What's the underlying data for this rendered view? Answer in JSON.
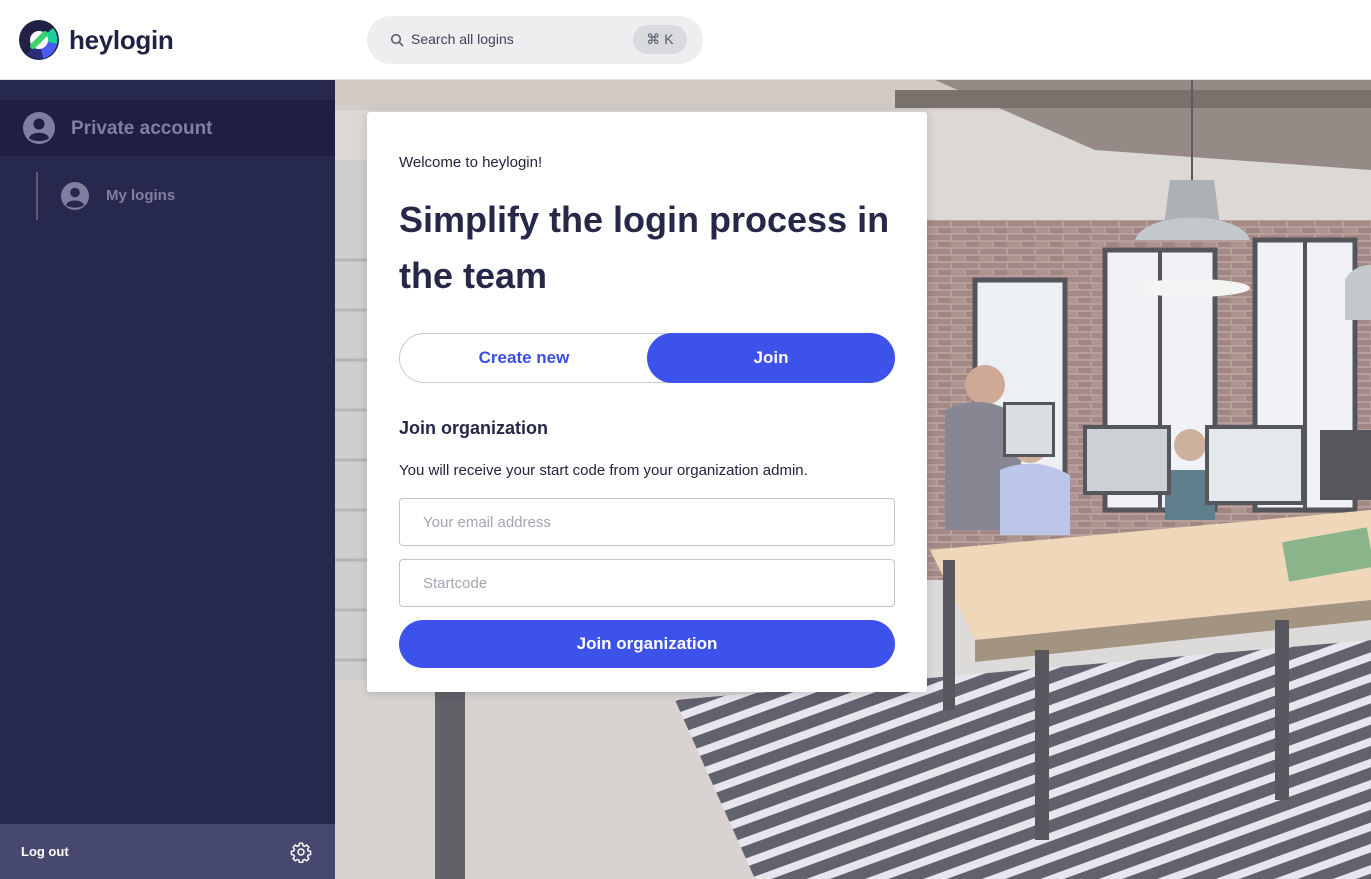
{
  "app": {
    "name": "heylogin"
  },
  "search": {
    "placeholder": "Search all logins",
    "shortcut": "⌘ K"
  },
  "sidebar": {
    "account_label": "Private account",
    "items": [
      {
        "label": "My logins",
        "icon": "user-circle-icon"
      }
    ],
    "logout_label": "Log out",
    "settings_icon": "gear-icon"
  },
  "card": {
    "welcome": "Welcome to heylogin!",
    "headline": "Simplify the login process in the team",
    "tabs": [
      {
        "label": "Create new",
        "active": false
      },
      {
        "label": "Join",
        "active": true
      }
    ],
    "section_title": "Join organization",
    "section_desc": "You will receive your start code from your organization admin.",
    "email_placeholder": "Your email address",
    "email_value": "",
    "code_placeholder": "Startcode",
    "code_value": "",
    "submit_label": "Join organization"
  },
  "colors": {
    "brand": "#3d52ea",
    "sidebar_bg": "#27284d",
    "sidebar_footer_bg": "#474870",
    "heading_text": "#262848"
  }
}
